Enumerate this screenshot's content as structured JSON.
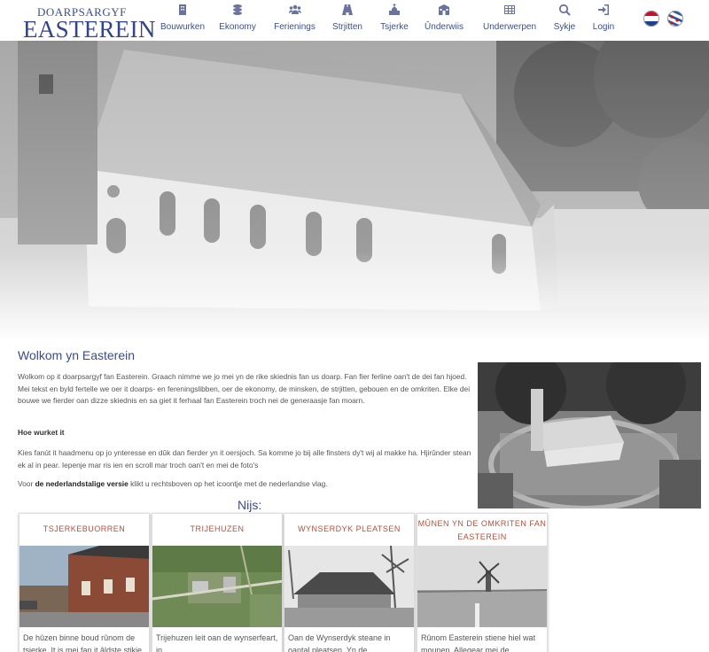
{
  "logo": {
    "top": "DOARPSARGYF",
    "main": "EASTEREIN"
  },
  "nav": [
    {
      "label": "Bouwurken",
      "icon": "building-icon"
    },
    {
      "label": "Ekonomy",
      "icon": "coins-icon"
    },
    {
      "label": "Ferienings",
      "icon": "users-icon"
    },
    {
      "label": "Strjitten",
      "icon": "road-icon"
    },
    {
      "label": "Tsjerke",
      "icon": "church-icon"
    },
    {
      "label": "Ûnderwiis",
      "icon": "school-icon"
    },
    {
      "label": "Underwerpen",
      "icon": "grid-icon"
    },
    {
      "label": "Sykje",
      "icon": "search-icon"
    },
    {
      "label": "Login",
      "icon": "login-icon"
    }
  ],
  "main": {
    "title": "Wolkom yn Easterein",
    "intro": "Wolkom op it doarpsargyf fan Easterein. Graach nimme we jo mei yn de rike skiednis fan us doarp. Fan fier ferline oan't de dei fan hjoed. Mei tekst en byld fertelle we oer it doarps- en fereningslibben, oer de ekonomy, de minsken, de strjitten, gebouen en de omkriten. Elke dei bouwe we fierder oan dizze skiednis en sa giet it ferhaal fan Easterein troch nei de generaasje fan moarn.",
    "howto_heading": "Hoe wurket it",
    "howto_text": "Kies fanút it haadmenu op jo ynteresse en dûk dan fierder yn it oersjoch. Sa komme jo bij alle finsters dy't wij al makke ha. Hjirûnder stean ek al in pear. Iepenje mar ris ien en scroll mar troch oan't en mei de foto's",
    "versie_pre": "Voor ",
    "versie_bold": "de nederlandstalige versie",
    "versie_post": " klikt u rechtsboven op het icoontje met de nederlandse vlag."
  },
  "news": {
    "heading": "Nijs:",
    "cards": [
      {
        "title": "TSJERKEBUORREN",
        "text": "De hûzen binne boud rûnom de tsjerke. It is mei fan it âldste stikje"
      },
      {
        "title": "TRIJEHUZEN",
        "text": "Trijehuzen leit oan de wynserfeart, in"
      },
      {
        "title": "WYNSERDYK PLEATSEN",
        "text": "Oan de Wynserdyk steane in oantal pleatsen. Yn de"
      },
      {
        "title": "MÛNEN YN DE OMKRITEN FAN EASTEREIN",
        "text": "Rûnom Easterein stiene hiel wat mounen. Allegear mei de"
      }
    ]
  },
  "colors": {
    "accent": "#3a4c8a",
    "card_title": "#b0513a"
  }
}
